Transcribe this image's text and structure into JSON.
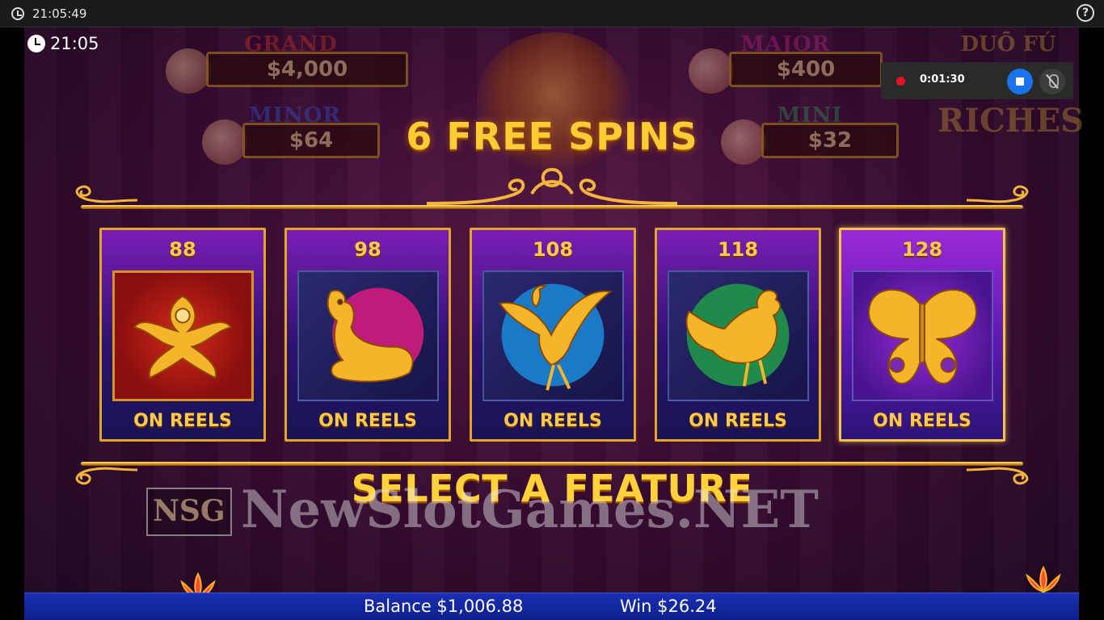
{
  "system": {
    "time": "21:05:49"
  },
  "overlay": {
    "clock": "21:05"
  },
  "jackpots": {
    "grand": {
      "label": "GRAND",
      "value": "$4,000"
    },
    "major": {
      "label": "MAJOR",
      "value": "$400"
    },
    "minor": {
      "label": "MINOR",
      "value": "$64"
    },
    "mini": {
      "label": "MINI",
      "value": "$32"
    }
  },
  "logo": {
    "line1": "DUŌ FÚ",
    "line2": "RICHES"
  },
  "recording": {
    "elapsed": "0:01:30"
  },
  "title": "6 FREE SPINS",
  "features": [
    {
      "count": "88",
      "label": "ON REELS",
      "symbol": "phoenix-icon"
    },
    {
      "count": "98",
      "label": "ON REELS",
      "symbol": "deer-icon"
    },
    {
      "count": "108",
      "label": "ON REELS",
      "symbol": "crane-icon"
    },
    {
      "count": "118",
      "label": "ON REELS",
      "symbol": "rooster-icon"
    },
    {
      "count": "128",
      "label": "ON REELS",
      "symbol": "butterfly-icon"
    }
  ],
  "prompt": "SELECT A FEATURE",
  "watermark": {
    "box": "NSG",
    "text": "NewSlotGames.NET"
  },
  "footer": {
    "balance": "Balance $1,006.88",
    "win": "Win $26.24"
  },
  "colors": {
    "gold": "#ffc94a",
    "card_border": "#e2a526",
    "bar": "#1a2fb5",
    "record": "#e81123",
    "stop": "#1a73e8"
  }
}
